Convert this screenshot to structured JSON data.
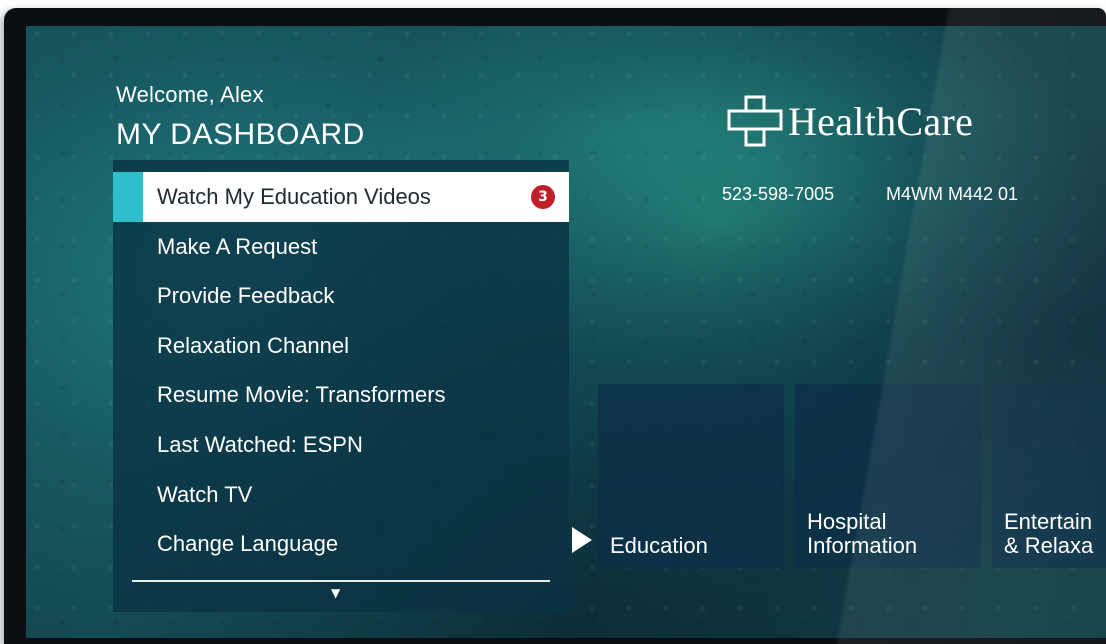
{
  "header": {
    "welcome": "Welcome, Alex",
    "title": "MY DASHBOARD"
  },
  "brand": {
    "name": "HealthCare",
    "logo_icon": "medical-cross-outline-icon"
  },
  "contact": {
    "phone": "523-598-7005",
    "room_code": "M4WM M442 01"
  },
  "menu": {
    "items": [
      {
        "label": "Watch My Education Videos",
        "badge": "3",
        "selected": true
      },
      {
        "label": "Make A Request"
      },
      {
        "label": "Provide Feedback"
      },
      {
        "label": "Relaxation Channel"
      },
      {
        "label": "Resume Movie: Transformers"
      },
      {
        "label": "Last Watched: ESPN"
      },
      {
        "label": "Watch TV"
      },
      {
        "label": "Change Language"
      }
    ],
    "scroll_icon": "triangle-down-icon"
  },
  "tiles": [
    {
      "line1": "Education",
      "line2": ""
    },
    {
      "line1": "Hospital",
      "line2": "Information"
    },
    {
      "line1": "Entertain",
      "line2": "& Relaxa"
    }
  ],
  "colors": {
    "accent": "#2fbfcc",
    "badge": "#c01f2a",
    "panel": "#0a3242"
  }
}
